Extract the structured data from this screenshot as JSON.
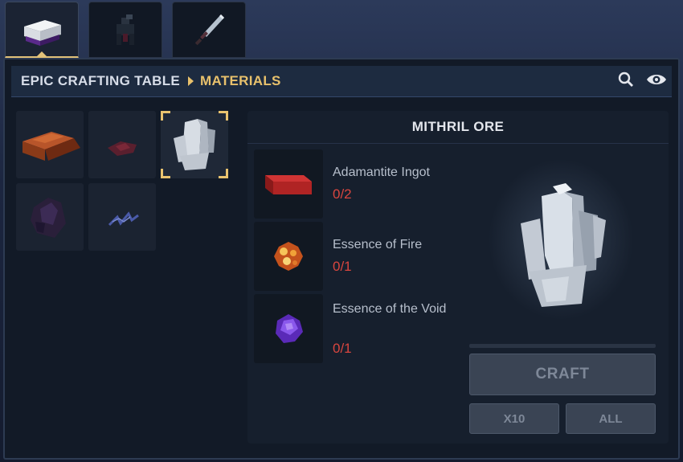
{
  "tabs": [
    {
      "name": "crafting-table",
      "active": true
    },
    {
      "name": "creatures",
      "active": false
    },
    {
      "name": "weapons",
      "active": false
    }
  ],
  "breadcrumb": {
    "root": "EPIC CRAFTING TABLE",
    "current": "MATERIALS"
  },
  "header_icons": [
    "search-icon",
    "eye-icon"
  ],
  "materials": [
    {
      "name": "adamantite-ingot-item",
      "icon": "red-ingot"
    },
    {
      "name": "red-shard-item",
      "icon": "red-shard"
    },
    {
      "name": "mithril-ore-item",
      "icon": "white-crystal",
      "selected": true
    },
    {
      "name": "void-crystal-item",
      "icon": "dark-crystal"
    },
    {
      "name": "void-spark-item",
      "icon": "blue-spark"
    }
  ],
  "detail": {
    "title": "MITHRIL ORE",
    "ingredients": [
      {
        "name": "Adamantite Ingot",
        "count": "0/2",
        "icon": "ingot-icon"
      },
      {
        "name": "Essence of Fire",
        "count": "0/1",
        "icon": "fire-essence-icon"
      },
      {
        "name": "Essence of the Void",
        "count": "0/1",
        "icon": "void-essence-icon"
      }
    ],
    "progress": 0,
    "buttons": {
      "craft": "CRAFT",
      "x10": "X10",
      "all": "ALL"
    }
  },
  "colors": {
    "accent": "#e8c16c",
    "missing": "#d9463f",
    "panel": "#121a27"
  }
}
